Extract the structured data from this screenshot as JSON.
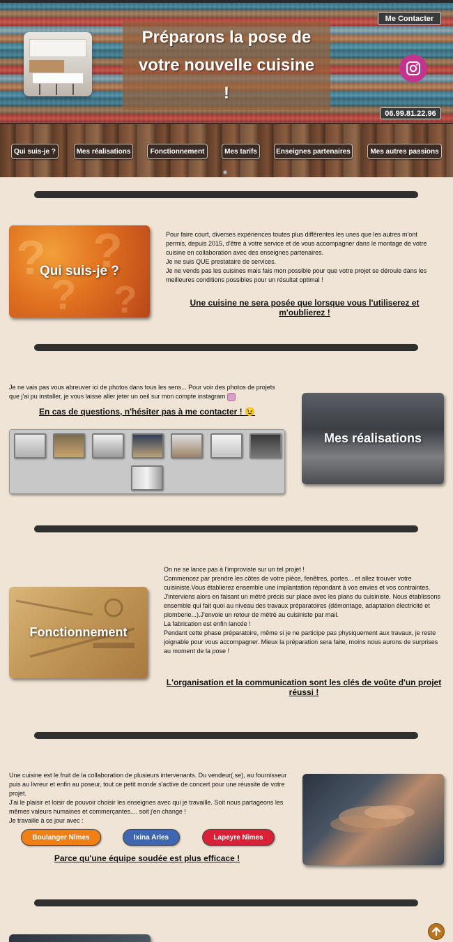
{
  "header": {
    "title": "Préparons la pose de votre nouvelle cuisine !",
    "contact_button": "Me Contacter",
    "phone": "06.99.81.22.96"
  },
  "nav": {
    "items": [
      {
        "label": "Qui suis-je ?"
      },
      {
        "label": "Mes réalisations"
      },
      {
        "label": "Fonctionnement"
      },
      {
        "label": "Mes tarifs"
      },
      {
        "label": "Enseignes partenaires"
      },
      {
        "label": "Mes autres passions"
      }
    ]
  },
  "sections": {
    "qui": {
      "card_title": "Qui suis-je ?",
      "text": [
        "Pour faire court, diverses expériences toutes plus différentes les unes que les autres m'ont permis, depuis 2015, d'être à votre service et de vous accompagner dans le montage de votre cuisine en collaboration avec des enseignes partenaires.",
        "Je ne suis QUE prestataire de services.",
        "Je ne vends pas les cuisines mais fais mon possible pour que votre projet se déroule dans les meilleures conditions possibles pour un résultat optimal !"
      ],
      "tagline": "Une cuisine ne sera posée que lorsque vous l'utiliserez et m'oublierez !"
    },
    "realisations": {
      "card_title": "Mes réalisations",
      "text": "Je ne vais pas vous abreuver ici de photos dans tous les sens... Pour voir des photos de projets que j'ai pu installer, je vous laisse aller jeter un oeil sur mon compte instagram",
      "tagline": "En cas de questions, n'hésiter pas à me contacter ! 😉"
    },
    "fonctionnement": {
      "card_title": "Fonctionnement",
      "text": [
        "On ne se lance pas à l'improviste sur un tel projet !",
        "Commencez par prendre les côtes de votre pièce, fenêtres, portes... et allez trouver votre cuisiniste.Vous établierez ensemble une implantation répondant à vos envies et vos contraintes. J'interviens alors en faisant un métré précis sur place avec les plans du cuisiniste. Nous établissons ensemble qui fait quoi au niveau des travaux préparatoires (démontage, adaptation électricité et plomberie...).J'envoie un retour de métré au cuisiniste par mail.",
        "La fabrication est enfin lancée !",
        "Pendant cette phase préparatoire, même si je ne participe pas physiquement aux travaux, je reste joignable pour vous accompagner. Mieux la préparation sera faite, moins nous aurons de surprises au moment de la pose !"
      ],
      "tagline": "L'organisation et la communication sont les clés de voûte d'un projet réussi !"
    },
    "enseignes": {
      "text": [
        "Une cuisine est le fruit de la collaboration de plusieurs intervenants. Du vendeur(.se), au fournisseur puis au livreur et enfin au poseur, tout ce petit monde s'active de concert pour une réussite de votre projet.",
        "J'ai le plaisir et loisir de pouvoir choisir les enseignes avec qui je travaille. Soit nous partageons les mêmes valeurs humaines et commerçantes.... soit j'en change !",
        "Je travaille à ce jour avec :"
      ],
      "partners": [
        {
          "label": "Boulanger Nîmes",
          "color": "#f07f16"
        },
        {
          "label": "Ixina Arles",
          "color": "#3f67b1"
        },
        {
          "label": "Lapeyre Nîmes",
          "color": "#d92036"
        }
      ],
      "tagline": "Parce qu'une équipe soudée est plus efficace !"
    }
  },
  "icons": {
    "instagram": "instagram-icon",
    "up": "arrow-up-icon"
  },
  "colors": {
    "page_bg": "#efe4d6",
    "divider": "#2f2f2f",
    "accent_orange": "#b8741f"
  }
}
